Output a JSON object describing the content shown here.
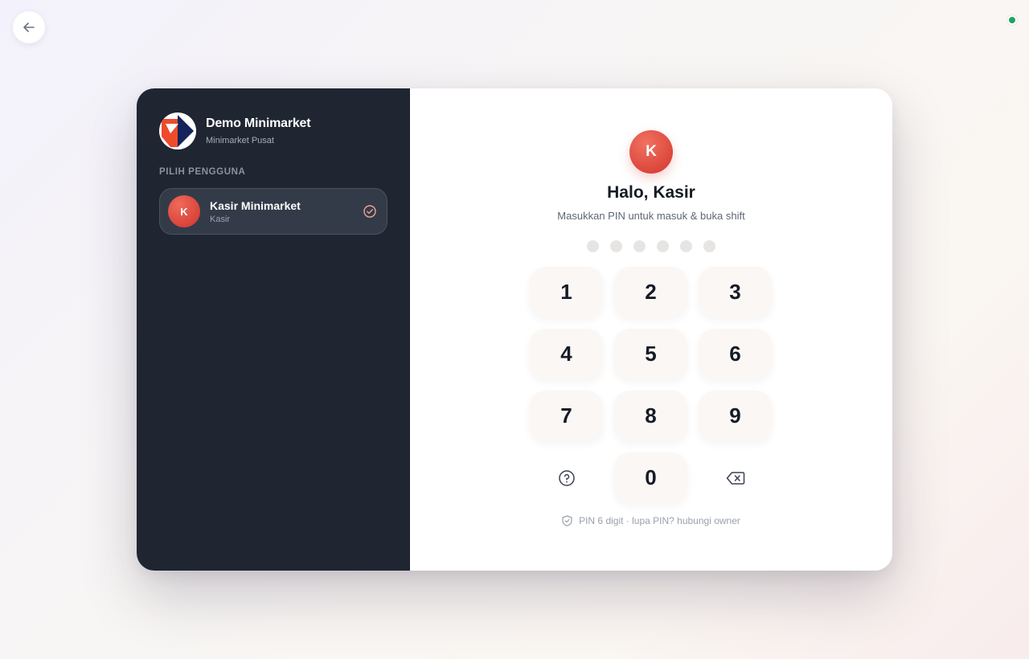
{
  "brand": {
    "name": "Demo Minimarket",
    "store": "Minimarket Pusat"
  },
  "user_section": {
    "label": "PILIH PENGGUNA",
    "users": [
      {
        "initial": "K",
        "name": "Kasir Minimarket",
        "role": "Kasir",
        "selected": true
      }
    ]
  },
  "login": {
    "avatar_initial": "K",
    "greeting": "Halo, Kasir",
    "instruction": "Masukkan PIN untuk masuk & buka shift",
    "pin_length": 6,
    "pin_filled": 0,
    "keys": [
      "1",
      "2",
      "3",
      "4",
      "5",
      "6",
      "7",
      "8",
      "9",
      "0"
    ],
    "footer_note": "PIN 6 digit · lupa PIN? hubungi owner"
  },
  "icons": {
    "back": "arrow-left-icon",
    "status": "online-status-dot",
    "help": "help-circle-icon",
    "backspace": "backspace-icon",
    "shield": "shield-check-icon",
    "check": "check-circle-icon"
  },
  "colors": {
    "sidebar_bg": "#1f2531",
    "accent_red": "#de4a3e",
    "status_green": "#1fa463"
  }
}
